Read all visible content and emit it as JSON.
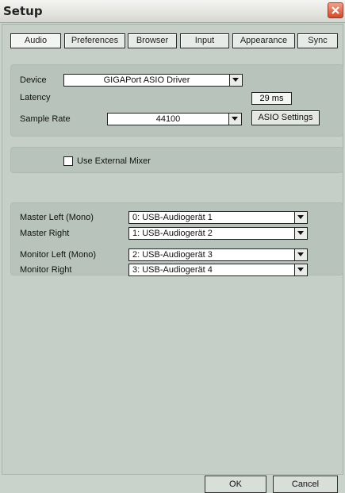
{
  "window": {
    "title": "Setup"
  },
  "tabs": [
    "Audio",
    "Preferences",
    "Browser",
    "Input",
    "Appearance",
    "Sync"
  ],
  "active_tab": "Audio",
  "device_panel": {
    "device_label": "Device",
    "device_value": "GIGAPort ASIO Driver",
    "latency_label": "Latency",
    "latency_value": "29 ms",
    "sample_rate_label": "Sample Rate",
    "sample_rate_value": "44100",
    "asio_settings_label": "ASIO Settings"
  },
  "mixer_panel": {
    "external_mixer_label": "Use External Mixer",
    "external_mixer_checked": false
  },
  "routing_panel": {
    "rows": [
      {
        "label": "Master Left (Mono)",
        "value": "0: USB-Audiogerät 1"
      },
      {
        "label": "Master Right",
        "value": "1: USB-Audiogerät 2"
      },
      {
        "label": "Monitor Left (Mono)",
        "value": "2: USB-Audiogerät 3"
      },
      {
        "label": "Monitor Right",
        "value": "3: USB-Audiogerät 4"
      }
    ]
  },
  "footer": {
    "ok_label": "OK",
    "cancel_label": "Cancel"
  },
  "colors": {
    "background": "#c9d3cb",
    "panel": "#b8c4bb",
    "close_button": "#d24a2c"
  },
  "icons": {
    "close": "close-icon",
    "dropdown": "chevron-down-icon"
  }
}
